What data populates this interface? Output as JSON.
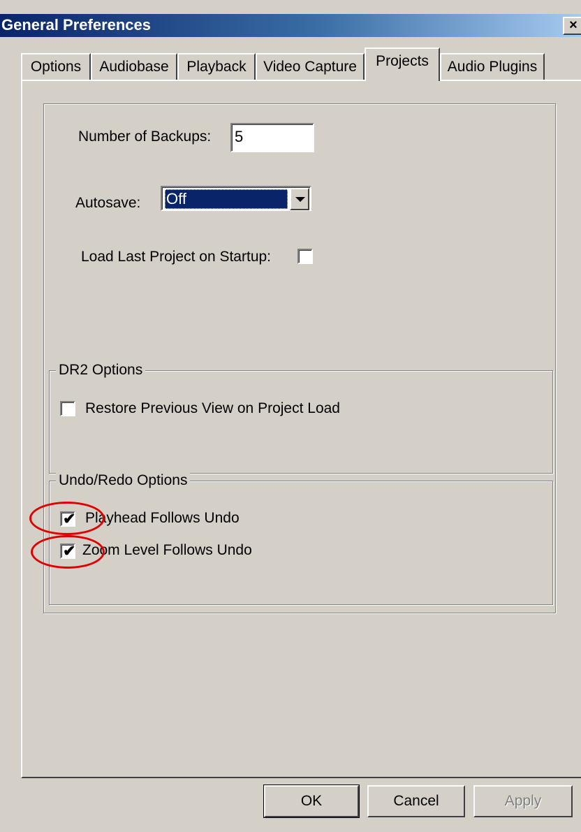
{
  "window": {
    "title": "General Preferences",
    "close_label": "×"
  },
  "tabs": [
    {
      "label": "Options",
      "active": false
    },
    {
      "label": "Audiobase",
      "active": false
    },
    {
      "label": "Playback",
      "active": false
    },
    {
      "label": "Video Capture",
      "active": false
    },
    {
      "label": "Projects",
      "active": true
    },
    {
      "label": "Audio Plugins",
      "active": false
    }
  ],
  "projects": {
    "backups_label": "Number of Backups:",
    "backups_value": "5",
    "autosave_label": "Autosave:",
    "autosave_value": "Off",
    "load_last_label": "Load Last Project on Startup:",
    "load_last_checked": false
  },
  "dr2_options": {
    "legend": "DR2 Options",
    "restore_view_label": "Restore Previous View on Project Load",
    "restore_view_checked": false
  },
  "undo_redo_options": {
    "legend": "Undo/Redo Options",
    "playhead_label": "Playhead Follows Undo",
    "playhead_checked": true,
    "zoom_label": "Zoom Level Follows Undo",
    "zoom_checked": true
  },
  "checkmark_glyph": "✔",
  "buttons": {
    "ok": "OK",
    "cancel": "Cancel",
    "apply": "Apply"
  },
  "colors": {
    "annotation": "#e00000",
    "titlebar": "#0a246a",
    "face": "#d4d0c8"
  }
}
